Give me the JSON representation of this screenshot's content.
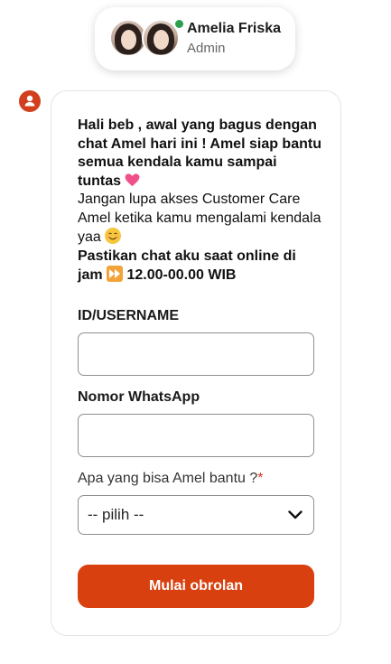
{
  "agent": {
    "name": "Amelia Friska",
    "role": "Admin",
    "status_color": "#2e9e4f"
  },
  "intro": {
    "line_bold_1": "Hali beb , awal yang bagus dengan chat Amel hari ini ! Amel siap bantu semua kendala kamu sampai tuntas",
    "emoji_1": "heart-emoji",
    "line_normal": "Jangan lupa akses Customer Care Amel ketika kamu mengalami kendala yaa",
    "emoji_2": "smile-emoji",
    "line_bold_2a": "Pastikan chat aku saat online di jam",
    "emoji_3": "fast-forward-emoji",
    "line_bold_2b": "12.00-00.00 WIB"
  },
  "form": {
    "username_label": "ID/USERNAME",
    "username_value": "",
    "whatsapp_label": "Nomor WhatsApp",
    "whatsapp_value": "",
    "help_label": "Apa yang bisa Amel bantu ?",
    "required_mark": "*",
    "help_selected": "-- pilih --",
    "submit_label": "Mulai obrolan"
  },
  "colors": {
    "accent": "#d9400f",
    "required": "#d9361a"
  }
}
